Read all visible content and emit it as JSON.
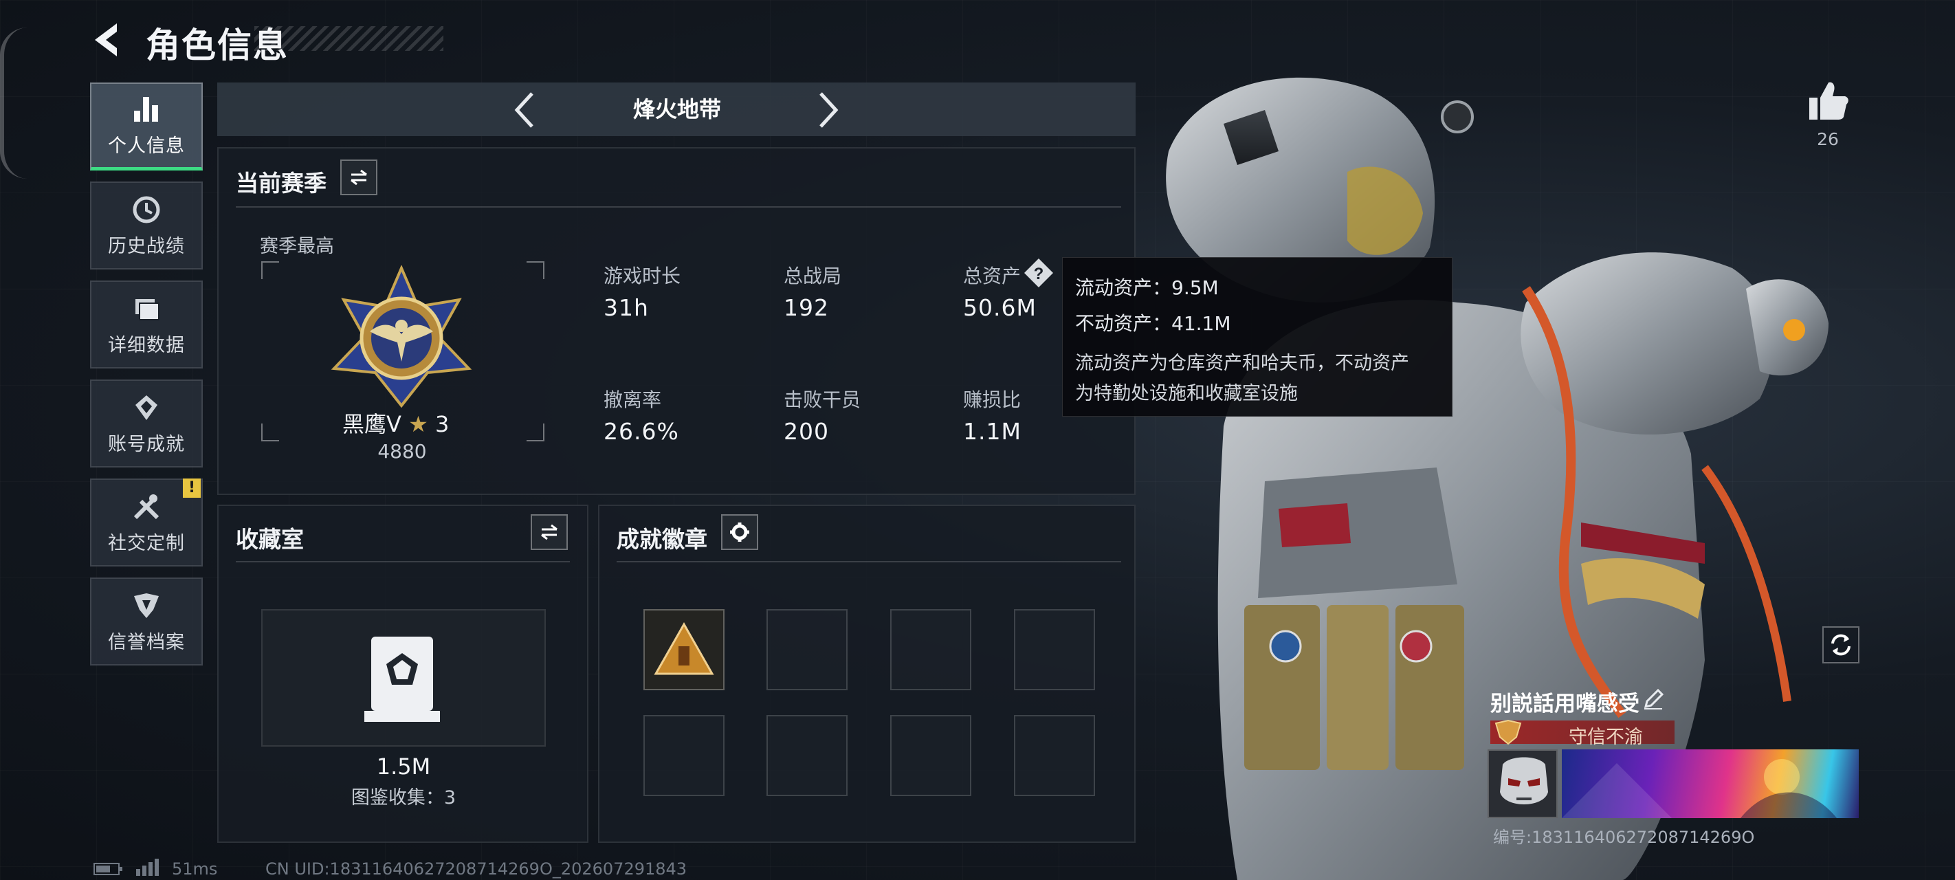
{
  "header": {
    "title": "角色信息"
  },
  "sidebar": {
    "items": [
      {
        "label": "个人信息",
        "icon": "bar-chart-icon",
        "active": true
      },
      {
        "label": "历史战绩",
        "icon": "history-clock-icon",
        "active": false
      },
      {
        "label": "详细数据",
        "icon": "folder-icon",
        "active": false
      },
      {
        "label": "账号成就",
        "icon": "medal-icon",
        "active": false
      },
      {
        "label": "社交定制",
        "icon": "tools-icon",
        "active": false,
        "badge": "!"
      },
      {
        "label": "信誉档案",
        "icon": "shield-emblem-icon",
        "active": false
      }
    ]
  },
  "mode_selector": {
    "title": "烽火地带"
  },
  "season": {
    "title": "当前赛季",
    "best_label": "赛季最高",
    "rank_name": "黑鹰V",
    "rank_stars": "3",
    "rank_score": "4880",
    "stats": [
      {
        "label": "游戏时长",
        "value": "31h"
      },
      {
        "label": "总战局",
        "value": "192"
      },
      {
        "label": "总资产",
        "value": "50.6M"
      },
      {
        "label": "撤离率",
        "value": "26.6%"
      },
      {
        "label": "击败干员",
        "value": "200"
      },
      {
        "label": "赚损比",
        "value": "1.1M"
      }
    ]
  },
  "tooltip": {
    "line1": "流动资产：9.5M",
    "line2": "不动资产：41.1M",
    "desc1": "流动资产为仓库资产和哈夫币，不动资产",
    "desc2": "为特勤处设施和收藏室设施"
  },
  "collection": {
    "title": "收藏室",
    "value": "1.5M",
    "catalog": "图鉴收集：3"
  },
  "badges": {
    "title": "成就徽章",
    "slots": [
      {
        "filled": true
      },
      {
        "filled": false
      },
      {
        "filled": false
      },
      {
        "filled": false
      },
      {
        "filled": false
      },
      {
        "filled": false
      },
      {
        "filled": false
      },
      {
        "filled": false
      }
    ]
  },
  "status_bar": {
    "ping": "51ms",
    "uid": "CN UID:18311640627208714269O_202607291843"
  },
  "profile": {
    "likes": "26",
    "player_name": "别説話用嘴感受",
    "reputation": "守信不渝",
    "player_id": "编号:18311640627208714269O"
  },
  "colors": {
    "active_accent": "#3ddc84",
    "reputation_red": "#a01e1e",
    "badge_yellow": "#e8c540"
  }
}
